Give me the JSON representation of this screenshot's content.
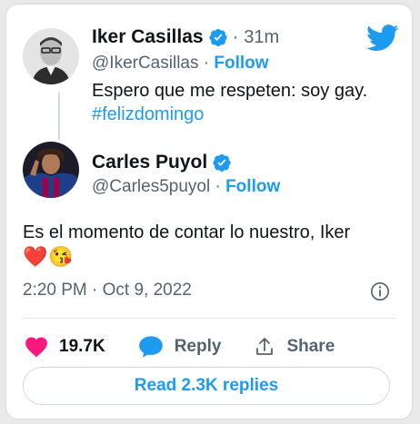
{
  "tweet1": {
    "name": "Iker Casillas",
    "time": "31m",
    "handle": "@IkerCasillas",
    "follow": "Follow",
    "text": "Espero que me respeten: soy gay.",
    "hashtag": "#felizdomingo"
  },
  "tweet2": {
    "name": "Carles Puyol",
    "handle": "@Carles5puyol",
    "follow": "Follow",
    "text": "Es el momento de contar lo nuestro, Iker",
    "emojis": [
      "❤️",
      "😘"
    ]
  },
  "meta": {
    "timestamp": "2:20 PM · Oct 9, 2022"
  },
  "actions": {
    "likes": "19.7K",
    "reply": "Reply",
    "share": "Share",
    "read_replies": "Read 2.3K replies"
  },
  "colors": {
    "accent": "#1d9bf0",
    "like": "#f91880",
    "secondary_text": "#536471"
  },
  "icons": [
    "verified-badge-icon",
    "twitter-bird-icon",
    "info-icon",
    "heart-icon",
    "reply-bubble-icon",
    "share-icon"
  ]
}
